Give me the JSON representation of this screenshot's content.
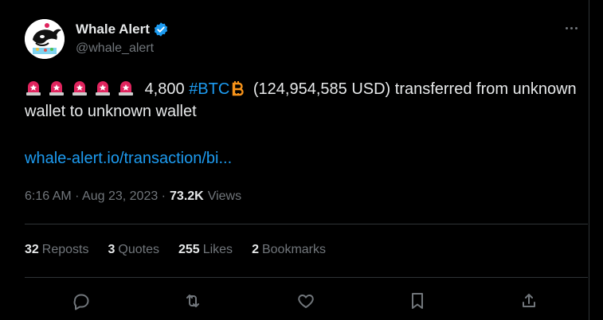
{
  "author": {
    "name": "Whale Alert",
    "handle": "@whale_alert",
    "verified_icon": "verified-badge-icon",
    "avatar_icon": "whale-avatar-icon"
  },
  "tweet": {
    "amount": "4,800",
    "hashtag": "#BTC",
    "usd": "(124,954,585 USD) transferred from unknown wallet to unknown wallet",
    "link": "whale-alert.io/transaction/bi..."
  },
  "meta": {
    "time_date": "6:16 AM · Aug 23, 2023 ·",
    "views_count": "73.2K",
    "views_label": "Views"
  },
  "stats": {
    "reposts_count": "32",
    "reposts_label": "Reposts",
    "quotes_count": "3",
    "quotes_label": "Quotes",
    "likes_count": "255",
    "likes_label": "Likes",
    "bookmarks_count": "2",
    "bookmarks_label": "Bookmarks"
  },
  "colors": {
    "background": "#000000",
    "text": "#e7e9ea",
    "muted": "#71767b",
    "accent": "#1d9bf0",
    "border": "#2f3336",
    "siren": "#e0245e",
    "bitcoin": "#f7931a"
  },
  "icons": [
    "police-siren-icon",
    "bitcoin-icon",
    "reply-icon",
    "repost-icon",
    "like-icon",
    "bookmark-icon",
    "share-icon",
    "more-icon"
  ]
}
